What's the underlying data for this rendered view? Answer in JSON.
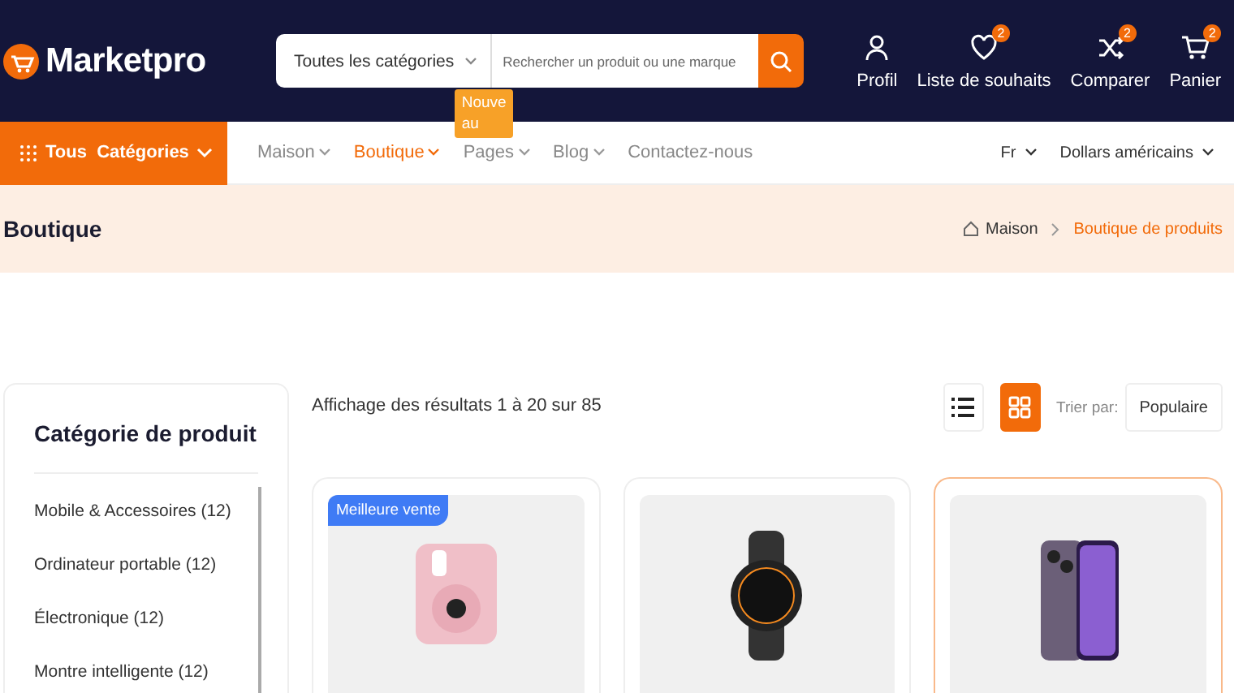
{
  "header": {
    "logo": "Marketpro",
    "search": {
      "category": "Toutes les catégories",
      "placeholder": "Rechercher un produit ou une marque"
    },
    "actions": [
      {
        "kind": "profile",
        "label": "Profil"
      },
      {
        "kind": "wishlist",
        "label": "Liste de souhaits",
        "count": "2"
      },
      {
        "kind": "compare",
        "label": "Comparer",
        "count": "2"
      },
      {
        "kind": "cart",
        "label": "Panier",
        "count": "2"
      }
    ]
  },
  "nav": {
    "categories_button": "Tous  Catégories",
    "items": [
      {
        "label": "Maison",
        "selected": false,
        "dropdown": true
      },
      {
        "label": "Boutique",
        "selected": true,
        "dropdown": true
      },
      {
        "label": "Pages",
        "selected": false,
        "dropdown": true,
        "badge": "Nouveau"
      },
      {
        "label": "Blog",
        "selected": false,
        "dropdown": true
      },
      {
        "label": "Contactez-nous",
        "selected": false,
        "dropdown": false
      }
    ],
    "language": "Fr",
    "currency": "Dollars américains"
  },
  "banner": {
    "title": "Boutique",
    "breadcrumb": [
      {
        "label": "Maison",
        "selected": false
      },
      {
        "label": "Boutique de produits",
        "selected": true
      }
    ]
  },
  "sidebar": {
    "title": "Catégorie de produit",
    "items": [
      "Mobile & Accessoires (12)",
      "Ordinateur portable (12)",
      "Électronique (12)",
      "Montre intelligente (12)"
    ]
  },
  "results": {
    "summary": "Affichage des résultats 1 à 20 sur 85",
    "views": [
      {
        "kind": "list",
        "selected": false
      },
      {
        "kind": "grid",
        "selected": true
      }
    ],
    "sort_label": "Trier par:",
    "sort_value": "Populaire"
  },
  "products": [
    {
      "kind": "camera",
      "badge": "Meilleure vente",
      "highlighted": false
    },
    {
      "kind": "watch",
      "highlighted": false
    },
    {
      "kind": "phone",
      "highlighted": true
    }
  ]
}
